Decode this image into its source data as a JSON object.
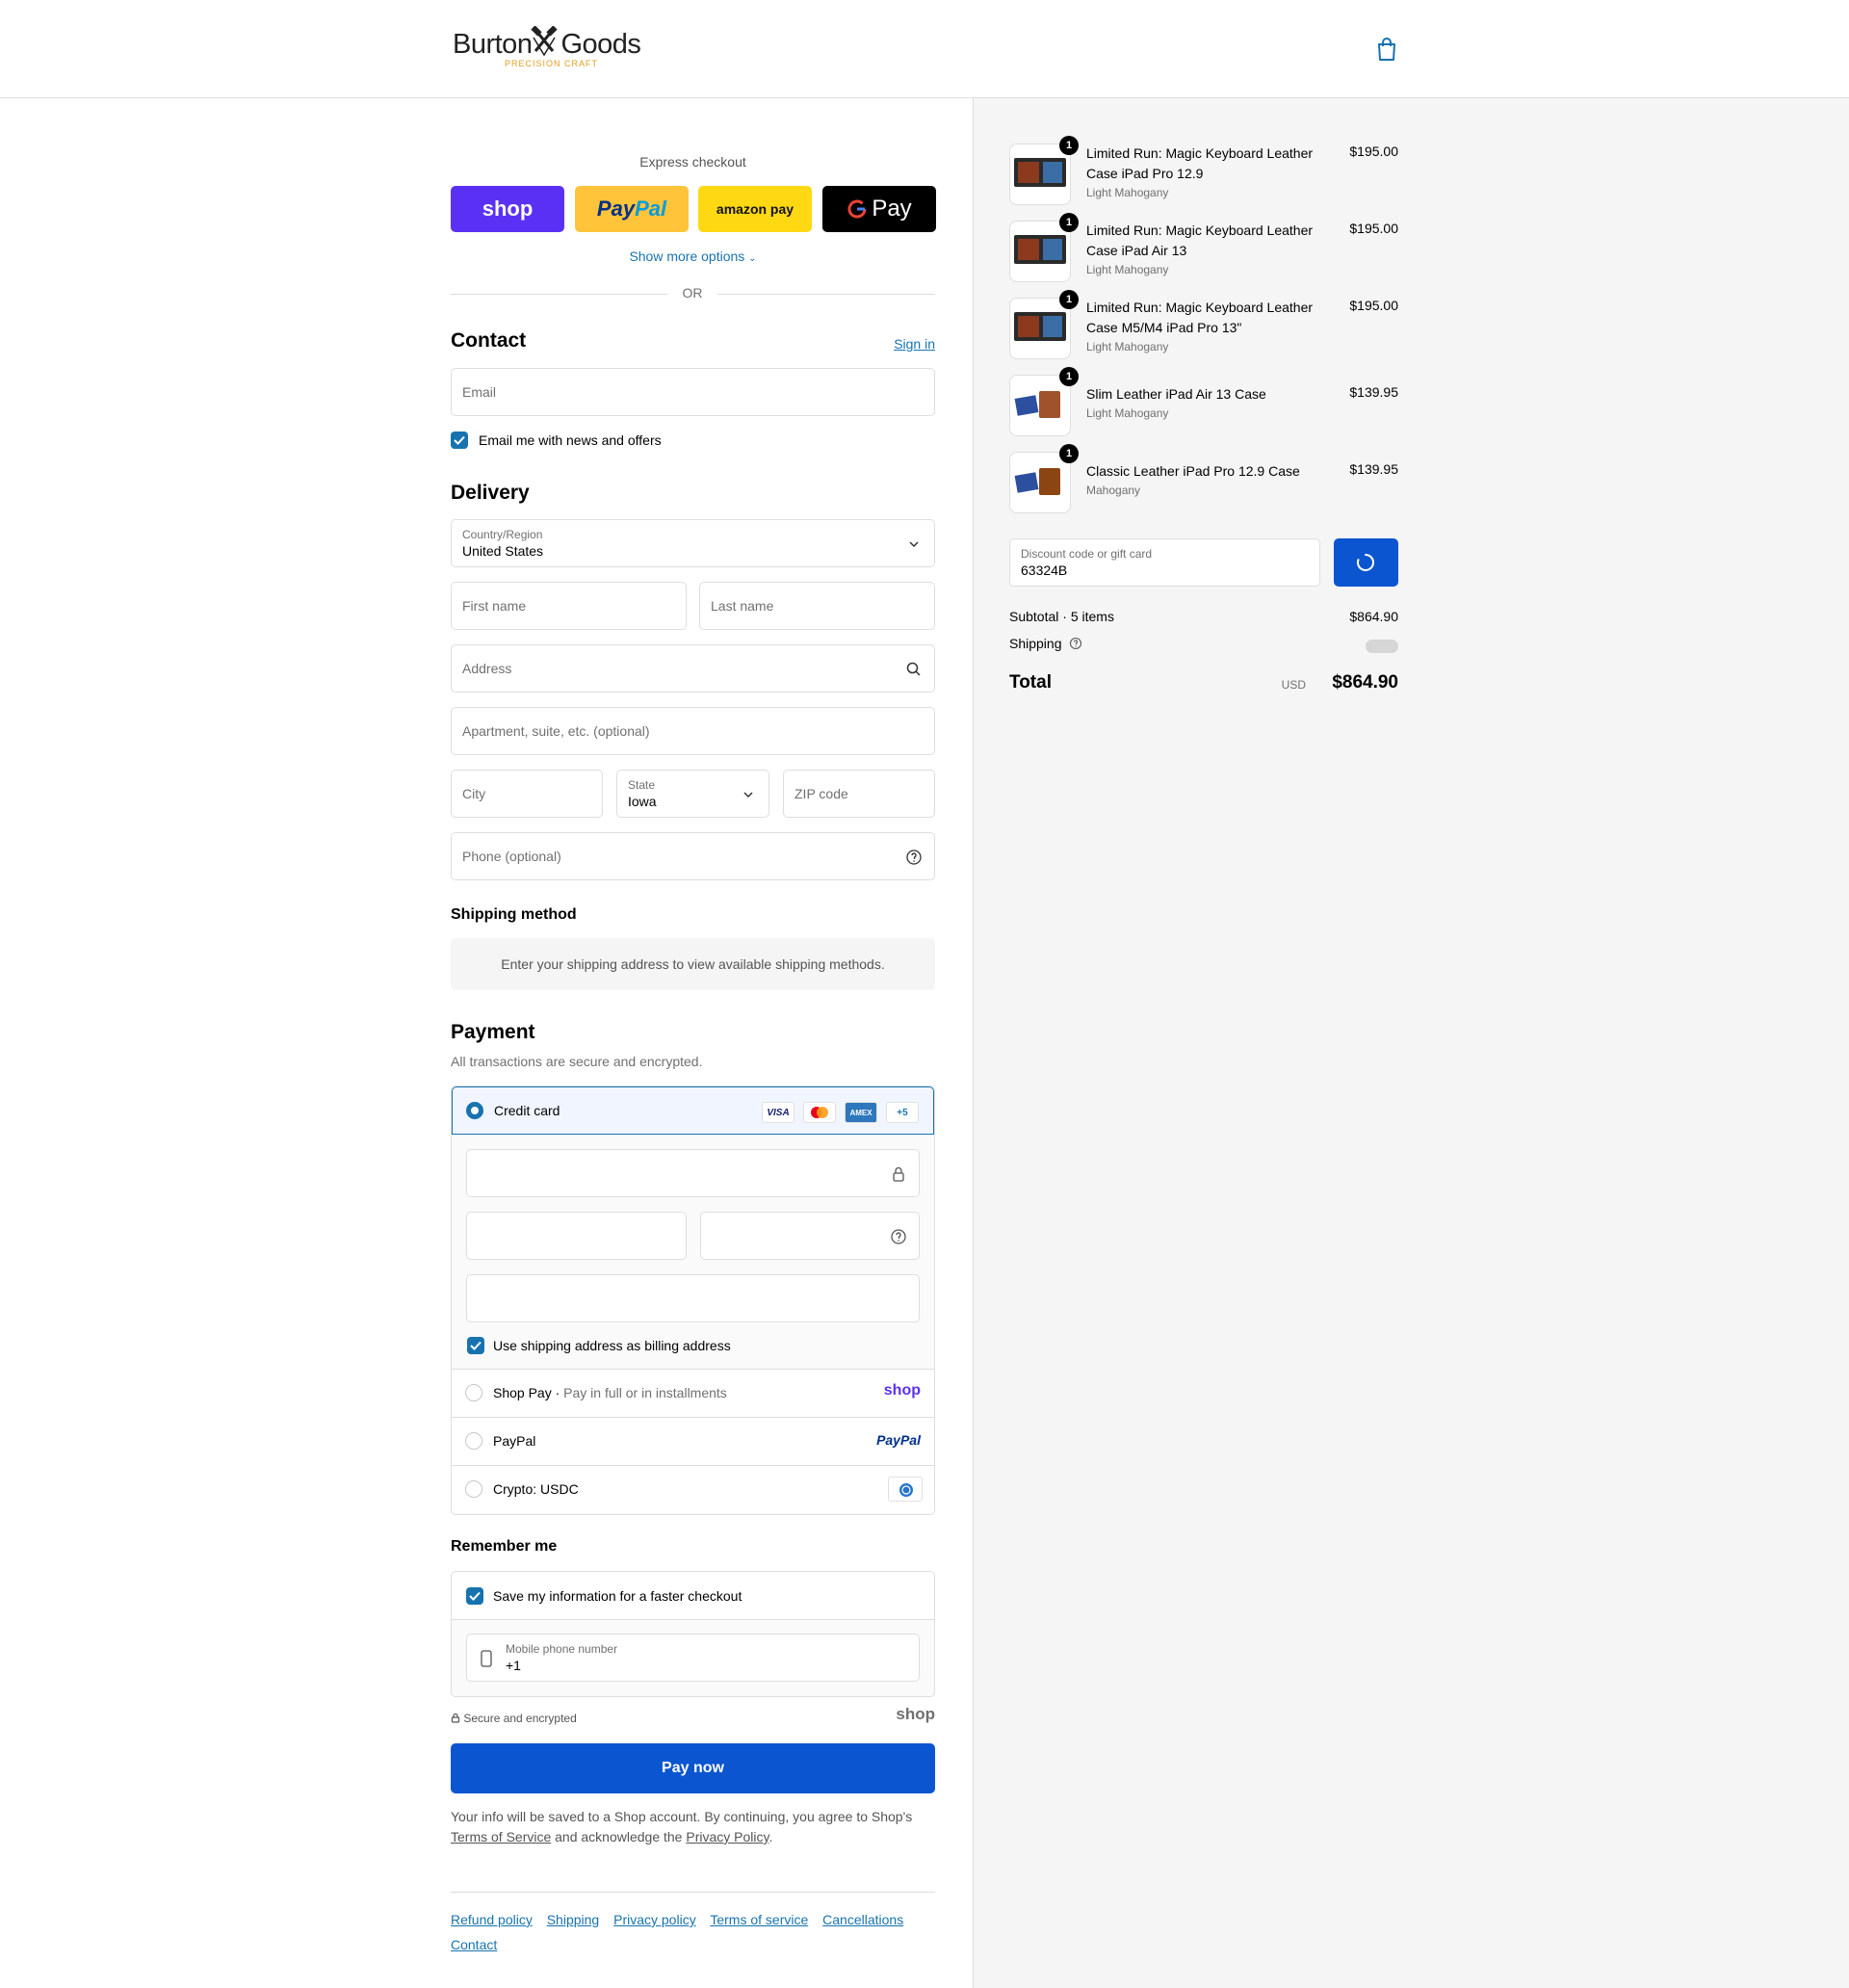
{
  "brand": {
    "name_left": "Burton",
    "name_right": "Goods",
    "tagline": "PRECISION CRAFT"
  },
  "express": {
    "title": "Express checkout",
    "shop_label": "shop",
    "paypal_pay": "Pay",
    "paypal_pal": "Pal",
    "amazon_label": "amazon pay",
    "gpay_label": "Pay",
    "more_options": "Show more options",
    "or_text": "OR"
  },
  "contact": {
    "title": "Contact",
    "sign_in": "Sign in",
    "email_placeholder": "Email",
    "newsletter_label": "Email me with news and offers"
  },
  "delivery": {
    "title": "Delivery",
    "country_label": "Country/Region",
    "country_value": "United States",
    "first_name": "First name",
    "last_name": "Last name",
    "address": "Address",
    "apartment": "Apartment, suite, etc. (optional)",
    "city": "City",
    "state_label": "State",
    "state_value": "Iowa",
    "zip": "ZIP code",
    "phone": "Phone (optional)"
  },
  "shipping_method": {
    "title": "Shipping method",
    "note": "Enter your shipping address to view available shipping methods."
  },
  "payment": {
    "title": "Payment",
    "subtitle": "All transactions are secure and encrypted.",
    "credit_card": "Credit card",
    "card_badges": [
      "VISA",
      "AMEX",
      "+5"
    ],
    "billing_same": "Use shipping address as billing address",
    "shop_pay": "Shop Pay",
    "shop_pay_sub": "Pay in full or in installments",
    "shop_pay_logo": "shop",
    "paypal": "PayPal",
    "paypal_logo": "PayPal",
    "crypto": "Crypto: USDC"
  },
  "remember": {
    "title": "Remember me",
    "save_label": "Save my information for a faster checkout",
    "phone_label": "Mobile phone number",
    "phone_value": "+1"
  },
  "secure_text": "Secure and encrypted",
  "shop_mark": "shop",
  "pay_now": "Pay now",
  "legal": {
    "text1": "Your info will be saved to a Shop account. By continuing, you agree to Shop's",
    "terms": "Terms of Service",
    "text2": "and acknowledge the",
    "privacy": "Privacy Policy",
    "end": "."
  },
  "footer": [
    "Refund policy",
    "Shipping",
    "Privacy policy",
    "Terms of service",
    "Cancellations",
    "Contact"
  ],
  "cart": {
    "items": [
      {
        "name": "Limited Run: Magic Keyboard Leather Case iPad Pro 12.9",
        "variant": "Light Mahogany",
        "price": "$195.00",
        "qty": "1"
      },
      {
        "name": "Limited Run: Magic Keyboard Leather Case iPad Air 13",
        "variant": "Light Mahogany",
        "price": "$195.00",
        "qty": "1"
      },
      {
        "name": "Limited Run: Magic Keyboard Leather Case M5/M4 iPad Pro 13\"",
        "variant": "Light Mahogany",
        "price": "$195.00",
        "qty": "1"
      },
      {
        "name": "Slim Leather iPad Air 13 Case",
        "variant": "Light Mahogany",
        "price": "$139.95",
        "qty": "1"
      },
      {
        "name": "Classic Leather iPad Pro 12.9 Case",
        "variant": "Mahogany",
        "price": "$139.95",
        "qty": "1"
      }
    ],
    "discount_label": "Discount code or gift card",
    "discount_value": "63324B",
    "subtotal_label": "Subtotal · 5 items",
    "subtotal_value": "$864.90",
    "shipping_label": "Shipping",
    "total_label": "Total",
    "currency": "USD",
    "total_value": "$864.90"
  },
  "colors": {
    "accent": "#1773b0",
    "pay_button": "#0b56d0",
    "shop_purple": "#5a31f4"
  }
}
